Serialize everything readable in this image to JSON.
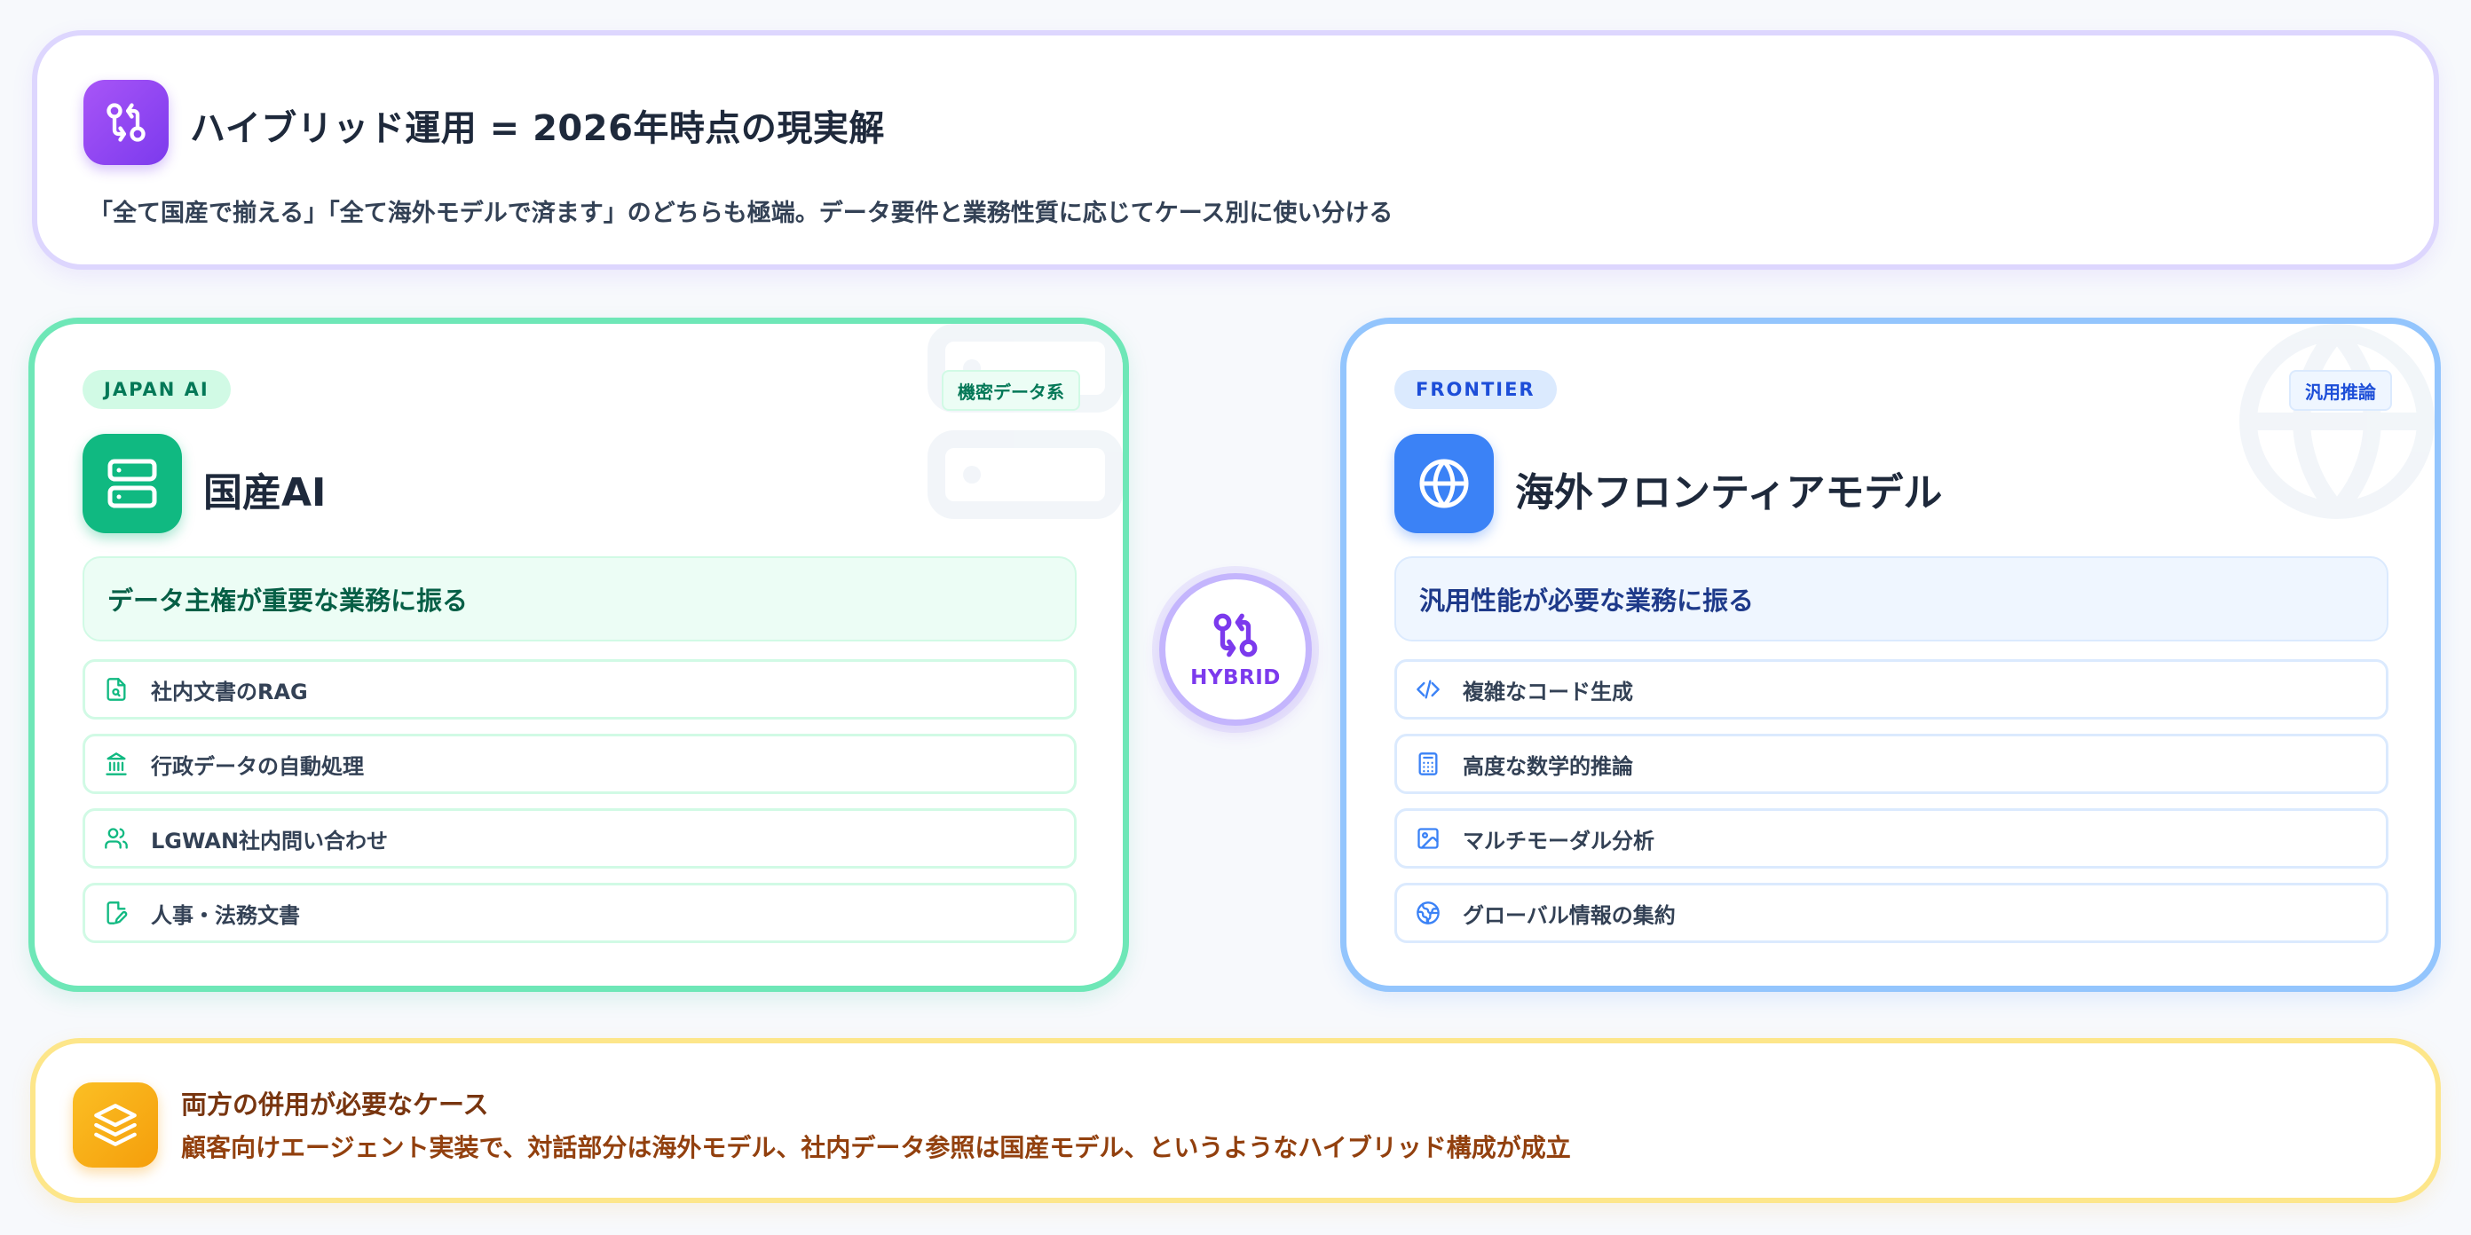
{
  "header": {
    "icon": "git-compare-icon",
    "title": "ハイブリッド運用 = 2026年時点の現実解",
    "subtitle": "「全て国産で揃える」「全て海外モデルで済ます」のどちらも極端。データ要件と業務性質に応じてケース別に使い分ける"
  },
  "japan": {
    "tag": "JAPAN AI",
    "badge": "機密データ系",
    "icon": "server-icon",
    "title": "国産AI",
    "role": "データ主権が重要な業務に振る",
    "accent": "#10b981",
    "items": [
      {
        "icon": "file-search-icon",
        "label": "社内文書のRAG"
      },
      {
        "icon": "landmark-icon",
        "label": "行政データの自動処理"
      },
      {
        "icon": "users-icon",
        "label": "LGWAN社内問い合わせ"
      },
      {
        "icon": "file-edit-icon",
        "label": "人事・法務文書"
      }
    ]
  },
  "hybrid": {
    "icon": "git-compare-icon",
    "label": "HYBRID",
    "accent": "#7c3aed"
  },
  "frontier": {
    "tag": "FRONTIER",
    "badge": "汎用推論",
    "icon": "globe-icon",
    "title": "海外フロンティアモデル",
    "role": "汎用性能が必要な業務に振る",
    "accent": "#3b82f6",
    "items": [
      {
        "icon": "code-icon",
        "label": "複雑なコード生成"
      },
      {
        "icon": "calculator-icon",
        "label": "高度な数学的推論"
      },
      {
        "icon": "image-icon",
        "label": "マルチモーダル分析"
      },
      {
        "icon": "globe-network-icon",
        "label": "グローバル情報の集約"
      }
    ]
  },
  "footer": {
    "icon": "layers-icon",
    "title": "両方の併用が必要なケース",
    "text": "顧客向けエージェント実装で、対話部分は海外モデル、社内データ参照は国産モデル、というようなハイブリッド構成が成立",
    "accent": "#f59e0b"
  }
}
